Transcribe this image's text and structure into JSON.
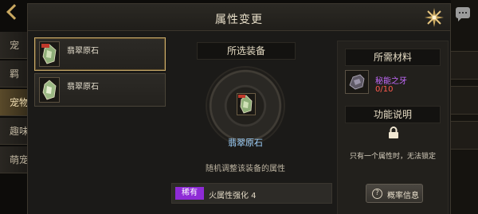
{
  "background": {
    "tabs": [
      "宠",
      "羁",
      "宠物",
      "趣味",
      "萌宠"
    ]
  },
  "modal": {
    "title": "属性变更"
  },
  "item_list": [
    {
      "name": "翡翠原石",
      "selected": true
    },
    {
      "name": "翡翠原石",
      "selected": false
    }
  ],
  "center": {
    "section_title": "所选装备",
    "equip_name": "翡翠原石",
    "description": "随机调整该装备的属性",
    "attribute": {
      "badge": "稀有",
      "text": "火属性强化 4"
    }
  },
  "right": {
    "materials_title": "所需材料",
    "material_name": "秘能之牙",
    "material_count": "0/10",
    "function_title": "功能说明",
    "note": "只有一个属性时，无法锁定",
    "rate_button": "概率信息",
    "rate_icon": "?"
  },
  "colors": {
    "rare_badge": "#8e2bd6",
    "material_name": "#c56bff",
    "material_count": "#ff5a4e",
    "equip_name": "#9fd3ff"
  }
}
